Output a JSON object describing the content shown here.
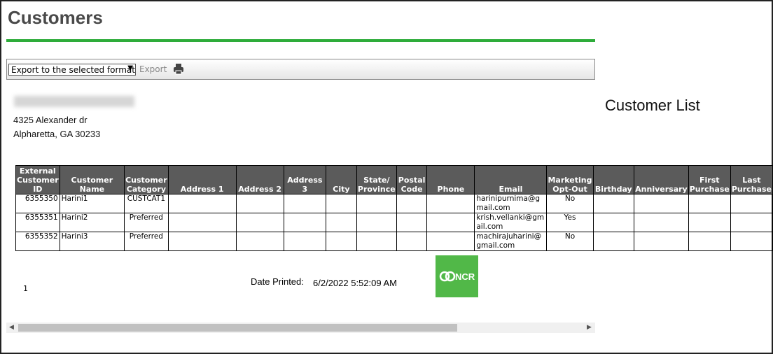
{
  "page": {
    "title": "Customers",
    "report_title": "Customer List"
  },
  "toolbar": {
    "export_select": "Export to the selected format",
    "export_label": "Export",
    "print_icon": "printer-icon"
  },
  "store": {
    "address_line1": "4325 Alexander dr",
    "address_line2": "Alpharetta, GA 30233"
  },
  "table": {
    "headers": [
      "External Customer ID",
      "Customer Name",
      "Customer Category",
      "Address 1",
      "Address 2",
      "Address 3",
      "City",
      "State/ Province",
      "Postal Code",
      "Phone",
      "Email",
      "Marketing Opt-Out",
      "Birthday",
      "Anniversary",
      "First Purchase",
      "Last Purchase"
    ],
    "rows": [
      [
        "6355350",
        "Harini1",
        "CUSTCAT1",
        "",
        "",
        "",
        "",
        "",
        "",
        "",
        "harinipurnima@gmail.com",
        "No",
        "",
        "",
        "",
        ""
      ],
      [
        "6355351",
        "Harini2",
        "Preferred",
        "",
        "",
        "",
        "",
        "",
        "",
        "",
        "krish.vellanki@gmail.com",
        "Yes",
        "",
        "",
        "",
        ""
      ],
      [
        "6355352",
        "Harini3",
        "Preferred",
        "",
        "",
        "",
        "",
        "",
        "",
        "",
        "machirajuharini@gmail.com",
        "No",
        "",
        "",
        "",
        ""
      ]
    ]
  },
  "footer": {
    "page_number": "1",
    "date_printed_label": "Date Printed:",
    "date_printed_value": "6/2/2022 5:52:09 AM",
    "logo_text": "NCR"
  },
  "colors": {
    "accent": "#2eac3a",
    "header_bg": "#5b5b5b",
    "logo_bg": "#51b848"
  }
}
